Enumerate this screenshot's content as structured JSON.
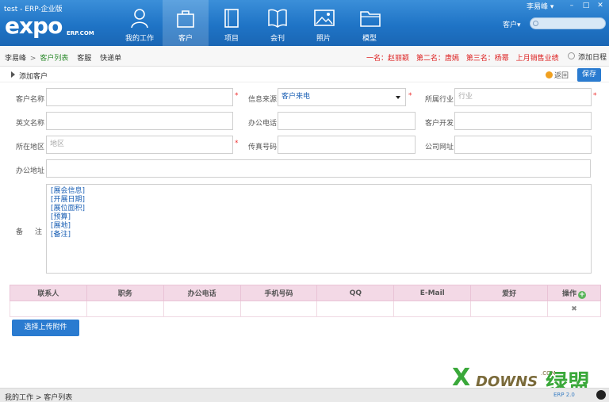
{
  "header": {
    "app_title": "test - ERP-企业版",
    "logo": "expo",
    "logo_sub": "ERP.COM",
    "nav": [
      {
        "label": "我的工作",
        "icon": "person-icon"
      },
      {
        "label": "客户",
        "icon": "briefcase-icon"
      },
      {
        "label": "项目",
        "icon": "document-icon"
      },
      {
        "label": "会刊",
        "icon": "book-icon"
      },
      {
        "label": "照片",
        "icon": "photo-icon"
      },
      {
        "label": "模型",
        "icon": "folder-icon"
      }
    ],
    "user": "李易峰 ▾",
    "win_minimize": "–",
    "win_maximize": "□",
    "win_close": "✕",
    "search_scope": "客户▾",
    "search_placeholder": ""
  },
  "subbar": {
    "crumb_user": "李易峰",
    "crumb_sep": ">",
    "crumb_current": "客户列表",
    "crumb_service": "客服",
    "crumb_quick": "快递单",
    "rank1": "一名：赵丽颖",
    "rank2": "第二名：唐嫣",
    "rank3": "第三名：杨幂",
    "sales_link": "上月销售业绩",
    "add_schedule": "添加日程"
  },
  "section": {
    "title": "添加客户",
    "back": "返回",
    "save": "保存"
  },
  "form": {
    "customer_name_label": "客户名称",
    "info_source_label": "信息来源",
    "info_source_value": "客户来电",
    "industry_label": "所属行业",
    "industry_placeholder": "行业",
    "en_name_label": "英文名称",
    "office_phone_label": "办公电话",
    "customer_dev_label": "客户开发",
    "region_label": "所在地区",
    "region_placeholder": "地区",
    "fax_label": "传真号码",
    "website_label": "公司网址",
    "address_label": "办公地址",
    "memo_label_1": "备",
    "memo_label_2": "注",
    "memo_lines": [
      "[展会信息]",
      "[开展日期]",
      "[展位面积]",
      "[预算]",
      "[展地]",
      "[备注]"
    ],
    "required_mark": "*"
  },
  "contacts": {
    "headers": [
      "联系人",
      "职务",
      "办公电话",
      "手机号码",
      "QQ",
      "E-Mail",
      "爱好",
      "操作"
    ],
    "add": "+",
    "delete": "✖"
  },
  "upload_label": "选择上传附件",
  "footer": {
    "crumbs": "我的工作 > 客户列表",
    "version": "ERP 2.0"
  },
  "watermark": {
    "x": "X",
    "text": "DOWNS",
    "com": ".COM",
    "cn": "绿盟"
  }
}
